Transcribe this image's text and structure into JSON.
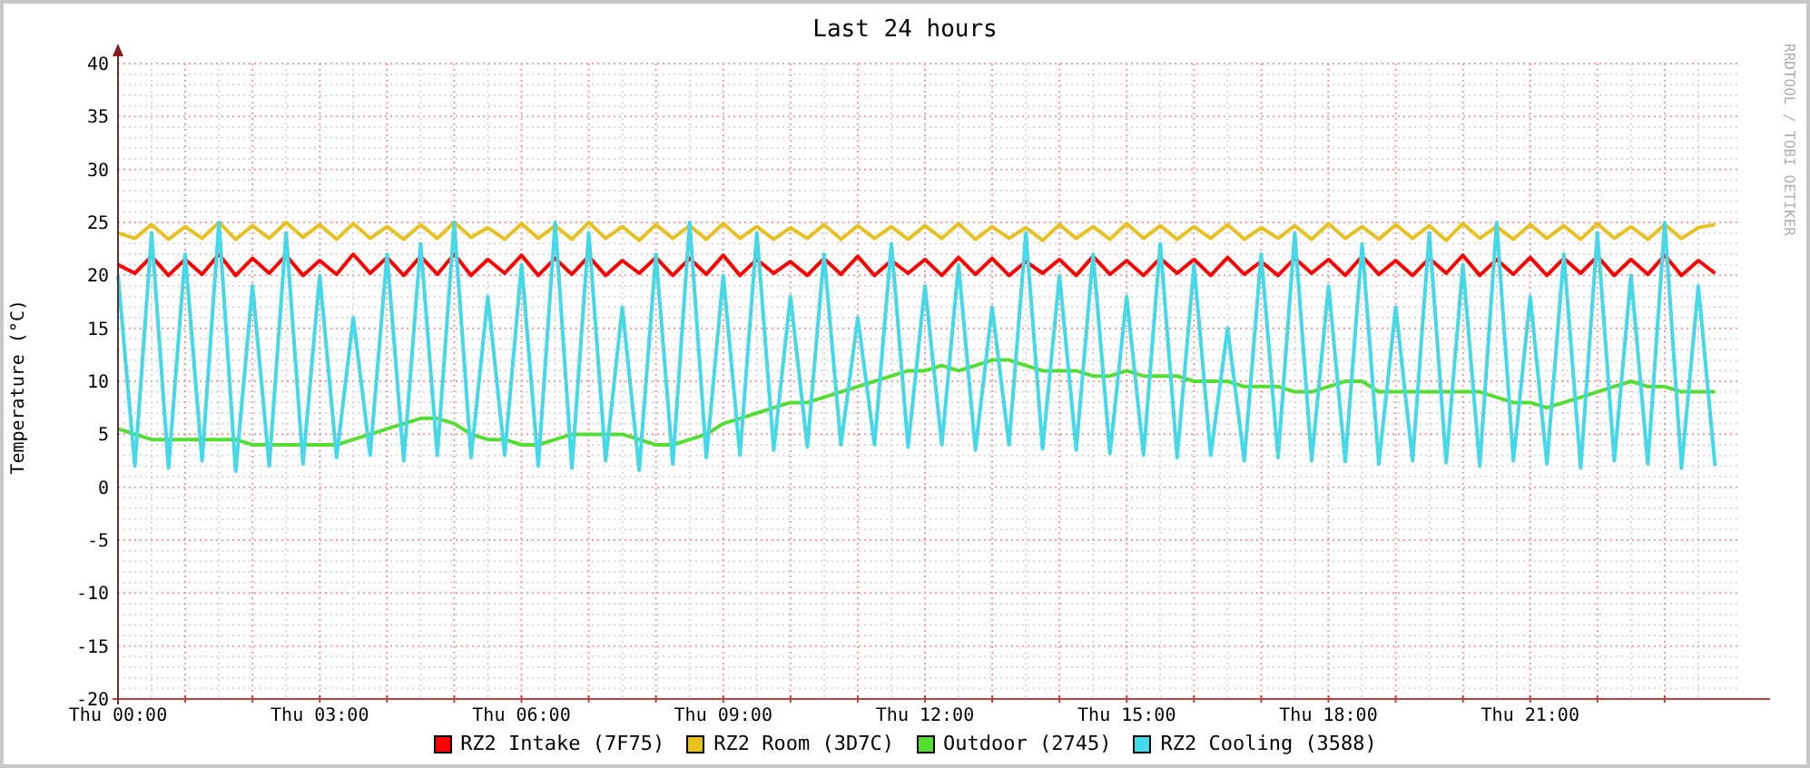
{
  "credit": "RRDTOOL / TOBI OETIKER",
  "chart": {
    "chart_data": {
      "type": "line",
      "grid": true,
      "title": "Last 24 hours",
      "ylabel": "Temperature (°C)",
      "ylim": [
        -20,
        40
      ],
      "categories": [
        "Thu 00:00",
        null,
        null,
        null,
        null,
        null,
        null,
        null,
        null,
        null,
        null,
        null,
        "Thu 03:00",
        null,
        null,
        null,
        null,
        null,
        null,
        null,
        null,
        null,
        null,
        null,
        "Thu 06:00",
        null,
        null,
        null,
        null,
        null,
        null,
        null,
        null,
        null,
        null,
        null,
        "Thu 09:00",
        null,
        null,
        null,
        null,
        null,
        null,
        null,
        null,
        null,
        null,
        null,
        "Thu 12:00",
        null,
        null,
        null,
        null,
        null,
        null,
        null,
        null,
        null,
        null,
        null,
        "Thu 15:00",
        null,
        null,
        null,
        null,
        null,
        null,
        null,
        null,
        null,
        null,
        null,
        "Thu 18:00",
        null,
        null,
        null,
        null,
        null,
        null,
        null,
        null,
        null,
        null,
        null,
        "Thu 21:00",
        null,
        null,
        null,
        null,
        null,
        null,
        null,
        null,
        null,
        null,
        null
      ],
      "yticks": [
        -20,
        -15,
        -10,
        -5,
        0,
        5,
        10,
        15,
        20,
        25,
        30,
        35,
        40
      ],
      "series": [
        {
          "name": "RZ2 Intake (7F75)",
          "color": "#ff0000",
          "values": [
            21,
            20.2,
            21.8,
            20,
            21.5,
            20.1,
            22,
            20,
            21.6,
            20.2,
            21.9,
            20,
            21.4,
            20.1,
            22,
            20.2,
            21.7,
            20,
            21.8,
            20.1,
            22,
            20,
            21.5,
            20.2,
            21.9,
            20,
            21.6,
            20.1,
            21.8,
            20,
            21.4,
            20.2,
            21.7,
            20,
            21.6,
            20.1,
            21.9,
            20,
            21.5,
            20.2,
            21.3,
            20,
            21.6,
            20.1,
            21.8,
            20,
            21.4,
            20.2,
            21.5,
            20,
            21.7,
            20.1,
            21.6,
            20,
            21.3,
            20.2,
            21.5,
            20,
            21.8,
            20.1,
            21.4,
            20,
            21.6,
            20.2,
            21.5,
            20,
            21.7,
            20.1,
            21.3,
            20,
            21.6,
            20.2,
            21.5,
            20,
            21.8,
            20.1,
            21.4,
            20,
            21.6,
            20.2,
            21.9,
            20,
            21.5,
            20.1,
            21.7,
            20,
            21.6,
            20.2,
            21.8,
            20,
            21.5,
            20.1,
            21.9,
            20,
            21.4,
            20.2
          ]
        },
        {
          "name": "RZ2 Room (3D7C)",
          "color": "#e8c020",
          "values": [
            24,
            23.5,
            24.8,
            23.4,
            24.6,
            23.5,
            25,
            23.4,
            24.7,
            23.5,
            25,
            23.6,
            24.8,
            23.4,
            24.9,
            23.5,
            24.6,
            23.4,
            24.8,
            23.5,
            25,
            23.6,
            24.5,
            23.4,
            24.9,
            23.5,
            24.7,
            23.4,
            25,
            23.5,
            24.6,
            23.3,
            24.8,
            23.5,
            24.7,
            23.4,
            24.9,
            23.5,
            24.6,
            23.4,
            24.5,
            23.5,
            24.8,
            23.4,
            24.7,
            23.5,
            24.6,
            23.4,
            24.7,
            23.5,
            24.9,
            23.4,
            24.6,
            23.5,
            24.5,
            23.3,
            24.8,
            23.5,
            24.6,
            23.4,
            24.9,
            23.5,
            24.7,
            23.4,
            24.6,
            23.5,
            24.8,
            23.4,
            24.5,
            23.5,
            24.7,
            23.4,
            24.9,
            23.5,
            24.6,
            23.4,
            24.8,
            23.5,
            24.7,
            23.3,
            24.9,
            23.5,
            24.6,
            23.4,
            24.8,
            23.5,
            24.7,
            23.4,
            24.9,
            23.5,
            24.6,
            23.4,
            24.8,
            23.5,
            24.5,
            24.8
          ]
        },
        {
          "name": "Outdoor (2745)",
          "color": "#55dd33",
          "values": [
            5.5,
            5,
            4.5,
            4.5,
            4.5,
            4.5,
            4.5,
            4.5,
            4,
            4,
            4,
            4,
            4,
            4,
            4.5,
            5,
            5.5,
            6,
            6.5,
            6.5,
            6,
            5,
            4.5,
            4.5,
            4,
            4,
            4.5,
            5,
            5,
            5,
            5,
            4.5,
            4,
            4,
            4.5,
            5,
            6,
            6.5,
            7,
            7.5,
            8,
            8,
            8.5,
            9,
            9.5,
            10,
            10.5,
            11,
            11,
            11.5,
            11,
            11.5,
            12,
            12,
            11.5,
            11,
            11,
            11,
            10.5,
            10.5,
            11,
            10.5,
            10.5,
            10.5,
            10,
            10,
            10,
            9.5,
            9.5,
            9.5,
            9,
            9,
            9.5,
            10,
            10,
            9,
            9,
            9,
            9,
            9,
            9,
            9,
            8.5,
            8,
            8,
            7.5,
            8,
            8.5,
            9,
            9.5,
            10,
            9.5,
            9.5,
            9,
            9,
            9
          ]
        },
        {
          "name": "RZ2 Cooling (3588)",
          "color": "#44d8e8",
          "values": [
            20,
            2,
            24,
            1.8,
            22,
            2.5,
            25,
            1.5,
            19,
            2,
            24,
            2.2,
            20,
            2.8,
            16,
            3,
            22,
            2.5,
            23,
            3,
            25,
            2.8,
            18,
            3,
            21,
            2,
            25,
            1.8,
            24,
            2.5,
            17,
            1.6,
            22,
            2.2,
            25,
            2.8,
            20,
            3,
            24,
            3.5,
            18,
            3.8,
            22,
            4,
            16,
            4,
            23,
            3.8,
            19,
            4,
            21,
            3.5,
            17,
            4,
            24,
            3.6,
            20,
            3.5,
            22,
            3.2,
            18,
            3,
            23,
            2.8,
            21,
            3,
            15,
            2.5,
            22,
            2.8,
            24,
            2.5,
            19,
            2.4,
            23,
            2.2,
            17,
            2.5,
            24,
            2.3,
            21,
            2,
            25,
            2.5,
            18,
            2.2,
            22,
            1.8,
            24,
            2.5,
            20,
            2.2,
            25,
            1.8,
            19,
            2
          ]
        }
      ]
    }
  }
}
